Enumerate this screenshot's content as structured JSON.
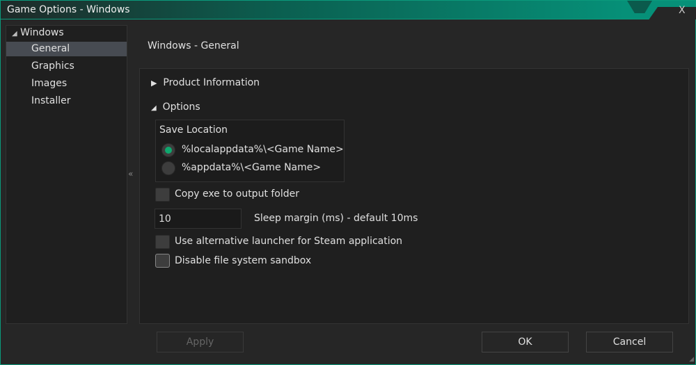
{
  "window": {
    "title": "Game Options - Windows",
    "close_label": "X"
  },
  "tree": {
    "root": "Windows",
    "items": [
      {
        "label": "General",
        "selected": true
      },
      {
        "label": "Graphics"
      },
      {
        "label": "Images"
      },
      {
        "label": "Installer"
      }
    ],
    "collapse_label": "«"
  },
  "main": {
    "heading": "Windows - General",
    "sections": {
      "product_info": "Product Information",
      "options": "Options"
    },
    "save_location": {
      "label": "Save Location",
      "options": [
        "%localappdata%\\<Game Name>",
        "%appdata%\\<Game Name>"
      ],
      "selected": 0
    },
    "copy_exe": {
      "label": "Copy exe to output folder",
      "checked": false
    },
    "sleep_margin": {
      "value": "10",
      "label": "Sleep margin (ms) - default 10ms"
    },
    "alt_launcher": {
      "label": "Use alternative launcher for Steam application",
      "checked": false
    },
    "disable_sandbox": {
      "label": "Disable file system sandbox",
      "checked": false
    }
  },
  "buttons": {
    "apply": "Apply",
    "ok": "OK",
    "cancel": "Cancel"
  },
  "colors": {
    "accent": "#0ea86e",
    "titlebar": "#069078"
  }
}
